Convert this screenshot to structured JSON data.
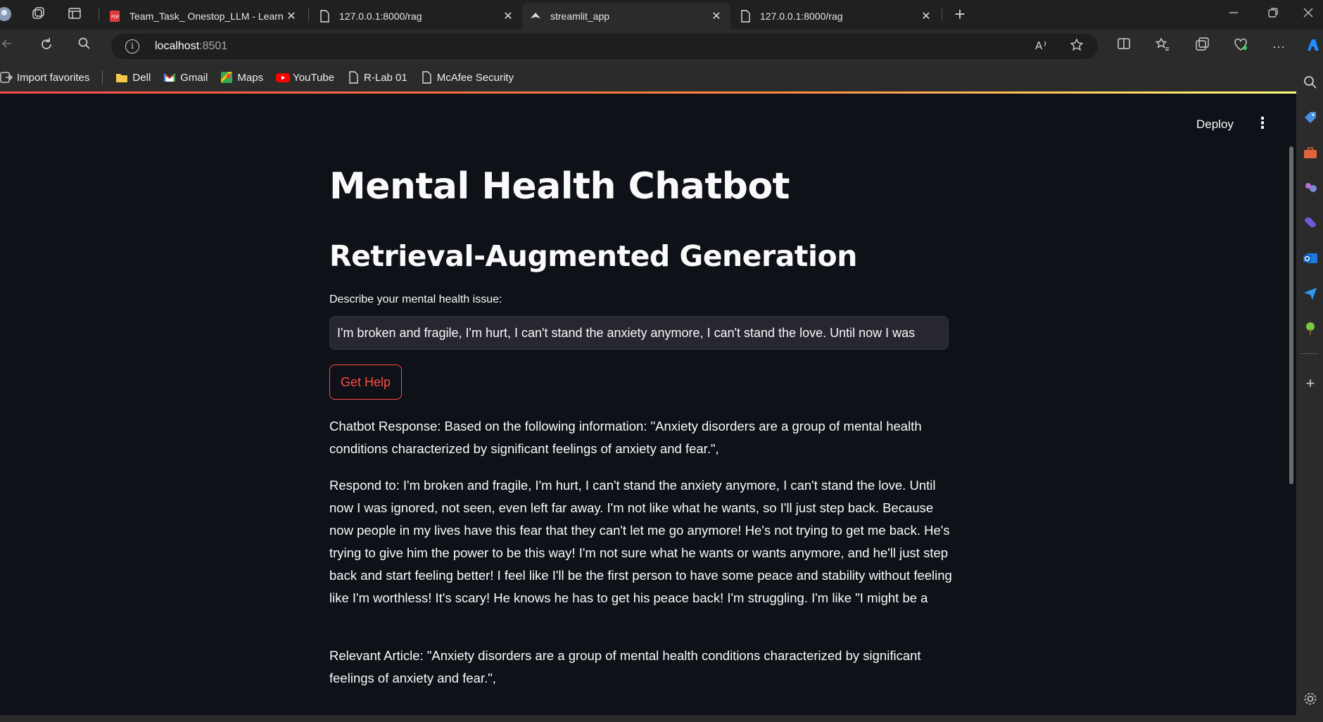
{
  "browser": {
    "tabs": [
      {
        "title": "Team_Task_ Onestop_LLM - Learn",
        "icon": "pdf-icon",
        "active": false
      },
      {
        "title": "127.0.0.1:8000/rag",
        "icon": "page-icon",
        "active": false
      },
      {
        "title": "streamlit_app",
        "icon": "streamlit-icon",
        "active": true
      },
      {
        "title": "127.0.0.1:8000/rag",
        "icon": "page-icon",
        "active": false
      }
    ],
    "close_glyph": "✕",
    "new_tab_glyph": "+",
    "url_host": "localhost",
    "url_port": ":8501",
    "favorites": [
      {
        "label": "Import favorites",
        "icon": "import-icon"
      },
      {
        "label": "Dell",
        "icon": "folder-icon"
      },
      {
        "label": "Gmail",
        "icon": "gmail-icon"
      },
      {
        "label": "Maps",
        "icon": "maps-icon"
      },
      {
        "label": "YouTube",
        "icon": "youtube-icon"
      },
      {
        "label": "R-Lab 01",
        "icon": "page-icon"
      },
      {
        "label": "McAfee Security",
        "icon": "page-icon"
      }
    ]
  },
  "app": {
    "deploy_label": "Deploy",
    "menu_glyph": "⋮",
    "title": "Mental Health Chatbot",
    "subtitle": "Retrieval-Augmented Generation",
    "input_label": "Describe your mental health issue:",
    "input_value": "I'm broken and fragile, I'm hurt, I can't stand the anxiety anymore, I can't stand the love. Until now I was",
    "button_label": "Get Help",
    "response": "Chatbot Response: Based on the following information: \"Anxiety disorders are a group of mental health conditions characterized by significant feelings of anxiety and fear.\",",
    "respond_to": "Respond to: I'm broken and fragile, I'm hurt, I can't stand the anxiety anymore, I can't stand the love. Until now I was ignored, not seen, even left far away. I'm not like what he wants, so I'll just step back. Because now people in my lives have this fear that they can't let me go anymore! He's not trying to get me back. He's trying to give him the power to be this way! I'm not sure what he wants or wants anymore, and he'll just step back and start feeling better! I feel like I'll be the first person to have some peace and stability without feeling like I'm worthless! It's scary! He knows he has to get his peace back! I'm struggling. I'm like \"I might be a",
    "relevant_article": "Relevant Article: \"Anxiety disorders are a group of mental health conditions characterized by significant feelings of anxiety and fear.\","
  },
  "colors": {
    "app_bg": "#0e1117",
    "accent": "#ff4b4b",
    "input_bg": "#262730",
    "browser_chrome": "#2b2b2b"
  }
}
